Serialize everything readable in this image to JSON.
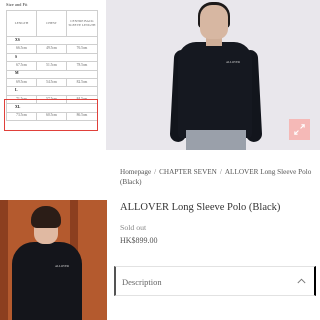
{
  "size_chart": {
    "title": "Size and Fit",
    "headers": [
      "LENGTH",
      "CHEST",
      "CENTRE BACK SLEEVE LENGTH"
    ],
    "rows": [
      {
        "size": "XS",
        "values": [
          "66.5cm",
          "49.5cm",
          "76.5cm"
        ]
      },
      {
        "size": "S",
        "values": [
          "67.5cm",
          "51.5cm",
          "78.5cm"
        ]
      },
      {
        "size": "M",
        "values": [
          "69.5cm",
          "54.5cm",
          "82.5cm"
        ]
      },
      {
        "size": "L",
        "values": [
          "71.5cm",
          "57.5cm",
          "84.5cm"
        ]
      },
      {
        "size": "XL",
        "values": [
          "73.5cm",
          "60.5cm",
          "86.5cm"
        ]
      }
    ],
    "highlight_color": "#e0403a"
  },
  "hero": {
    "chest_print": "ALLOVER",
    "zoom_icon": "expand-arrows-icon",
    "zoom_color": "#f5b9b7"
  },
  "model": {
    "chest_print": "ALLOVER"
  },
  "breadcrumb": {
    "home": "Homepage",
    "category": "CHAPTER SEVEN",
    "current": "ALLOVER Long Sleeve Polo (Black)",
    "separator": "/"
  },
  "product": {
    "title": "ALLOVER Long Sleeve Polo (Black)",
    "stock_status": "Sold out",
    "price": "HK$899.00"
  },
  "accordion": {
    "label": "Description",
    "icon": "chevron-up-icon"
  }
}
